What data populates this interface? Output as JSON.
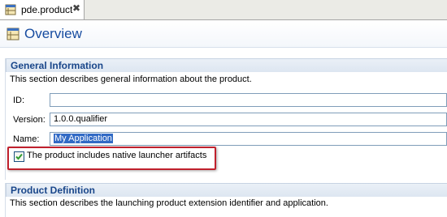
{
  "tab": {
    "label": "pde.product",
    "close_glyph": "✖"
  },
  "header": {
    "title": "Overview"
  },
  "general": {
    "title": "General Information",
    "description": "This section describes general information about the product.",
    "fields": {
      "id": {
        "label": "ID:",
        "value": ""
      },
      "version": {
        "label": "Version:",
        "value": "1.0.0.qualifier"
      },
      "name": {
        "label": "Name:",
        "value": "My Application",
        "selected": true
      }
    },
    "launcher_checkbox": {
      "label": "The product includes native launcher artifacts",
      "checked": true
    }
  },
  "product_definition": {
    "title": "Product Definition",
    "description": "This section describes the launching product extension identifier and application."
  },
  "colors": {
    "accent": "#174ca0",
    "highlight": "#c0202d",
    "selection": "#316ac5",
    "check": "#2e9b2e"
  },
  "icons": {
    "tab": "product-file-icon",
    "header": "product-overview-icon",
    "close": "close-icon",
    "check": "checkmark-icon"
  }
}
